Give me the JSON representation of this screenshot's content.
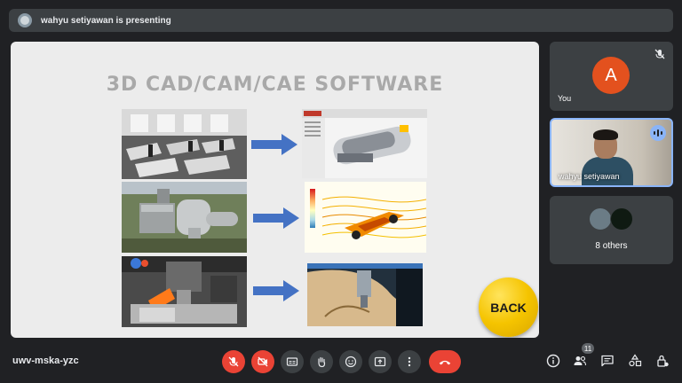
{
  "banner": {
    "text": "wahyu setiyawan is presenting"
  },
  "slide": {
    "title": "3D CAD/CAM/CAE SOFTWARE",
    "back_label": "BACK"
  },
  "participants": {
    "you": {
      "initial": "A",
      "name": "You",
      "avatar_color": "#e3511e"
    },
    "presenter": {
      "name": "wahyu setiyawan"
    },
    "others": {
      "label": "8 others"
    }
  },
  "meeting": {
    "code": "uwv-mska-yzc",
    "participant_count": "11"
  },
  "colors": {
    "danger": "#ea4335",
    "control_bg": "#3c4043",
    "active_border": "#8ab4f8",
    "arrow": "#4472c4"
  },
  "controls": [
    {
      "name": "mic-off-icon"
    },
    {
      "name": "camera-off-icon"
    },
    {
      "name": "captions-icon"
    },
    {
      "name": "raise-hand-icon"
    },
    {
      "name": "emoji-icon"
    },
    {
      "name": "present-icon"
    },
    {
      "name": "more-options-icon"
    },
    {
      "name": "end-call-icon"
    }
  ]
}
